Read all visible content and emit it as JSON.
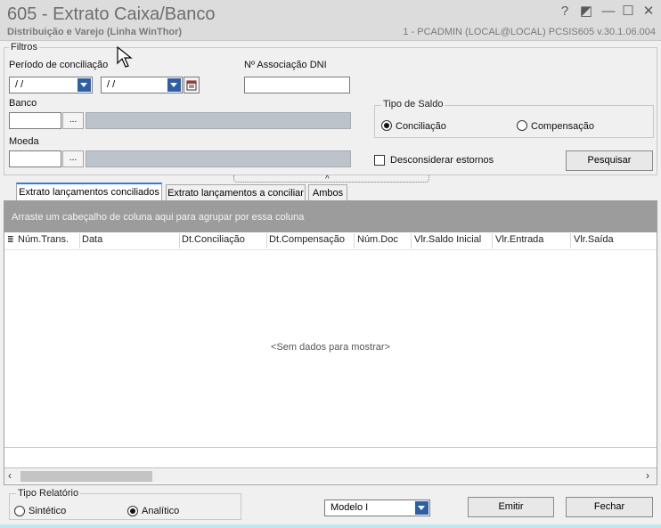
{
  "window": {
    "title": "605 - Extrato Caixa/Banco",
    "subtitle": "Distribuição e Varejo (Linha WinThor)",
    "session_info": "1 - PCADMIN (LOCAL@LOCAL)   PCSIS605  v.30.1.06.004",
    "buttons": {
      "help": "?",
      "restore": "◩",
      "minimize": "—",
      "maximize": "☐",
      "close": "✕"
    }
  },
  "filters": {
    "group_label": "Filtros",
    "periodo_label": "Período de conciliação",
    "date_from": "/ /",
    "date_to": "/ /",
    "dni_label": "Nº Associação DNI",
    "dni_value": "",
    "banco_label": "Banco",
    "banco_value": "",
    "moeda_label": "Moeda",
    "moeda_value": "",
    "ellipsis": "...",
    "tipo_saldo_label": "Tipo de Saldo",
    "conciliacao_label": "Conciliação",
    "compensacao_label": "Compensação",
    "desconsiderar_label": "Desconsiderar estornos",
    "pesquisar_label": "Pesquisar"
  },
  "tabs": [
    {
      "label": "Extrato lançamentos conciliados"
    },
    {
      "label": "Extrato lançamentos a conciliar"
    },
    {
      "label": "Ambos"
    }
  ],
  "grid": {
    "group_hint": "Arraste um cabeçalho de coluna aqui para agrupar por essa coluna",
    "columns": [
      "Núm.Trans.",
      "Data",
      "Dt.Conciliação",
      "Dt.Compensação",
      "Núm.Doc",
      "Vlr.Saldo Inicial",
      "Vlr.Entrada",
      "Vlr.Saída"
    ],
    "empty_text": "<Sem dados para mostrar>"
  },
  "footer": {
    "tipo_relatorio_label": "Tipo Relatório",
    "sintetico_label": "Sintético",
    "analitico_label": "Analítico",
    "modelo_value": "Modelo I",
    "emitir_label": "Emitir",
    "fechar_label": "Fechar"
  }
}
